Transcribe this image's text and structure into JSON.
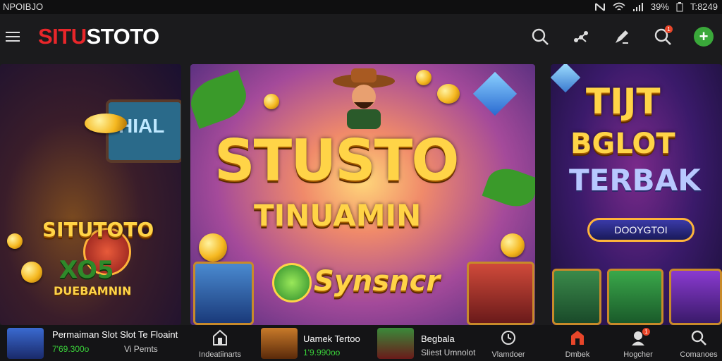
{
  "status_bar": {
    "left_text": "NPOIBJO",
    "battery": "39%",
    "time": "T:8249",
    "icons": [
      "nfc-icon",
      "wifi-icon",
      "signal-icon",
      "battery-icon"
    ]
  },
  "app_bar": {
    "brand_red": "SITU",
    "brand_white": "STOTO",
    "icons": [
      "search-icon",
      "share-icon",
      "edit-icon",
      "search-alt-icon",
      "add-icon"
    ],
    "notification_badge": "1",
    "accent": "#e8262a"
  },
  "banners": {
    "left": {
      "screen_text": "HIAL",
      "title": "SITUTOTO",
      "sub1": "XO5",
      "sub2": "DUEBAMNIN"
    },
    "center": {
      "title": "STUSTO",
      "subtitle": "TINUAMIN",
      "logo": "Synsncr"
    },
    "right": {
      "line1": "TIJT",
      "line2": "BGLOT",
      "line3": "TERBAK",
      "button": "DOOYGTOI"
    }
  },
  "bottom_bar": {
    "item1": {
      "title": "Permaiman Slot Slot Te Floaint",
      "value": "7'69.300o",
      "sub": "Vi Pemts"
    },
    "nav1": {
      "label": "Indeatiinarts"
    },
    "item2": {
      "title": "Uamek Tertoo",
      "value": "1'9.990oo"
    },
    "item3": {
      "title": "Begbala",
      "sub": "Sliest Umnolot"
    },
    "nav2": {
      "label": "Vlamdoer"
    },
    "nav3": {
      "label": "Dmbek"
    },
    "nav4": {
      "label": "Hogcher",
      "badge": "1"
    },
    "nav5": {
      "label": "Comanoes"
    },
    "value_color": "#3ad23a"
  }
}
